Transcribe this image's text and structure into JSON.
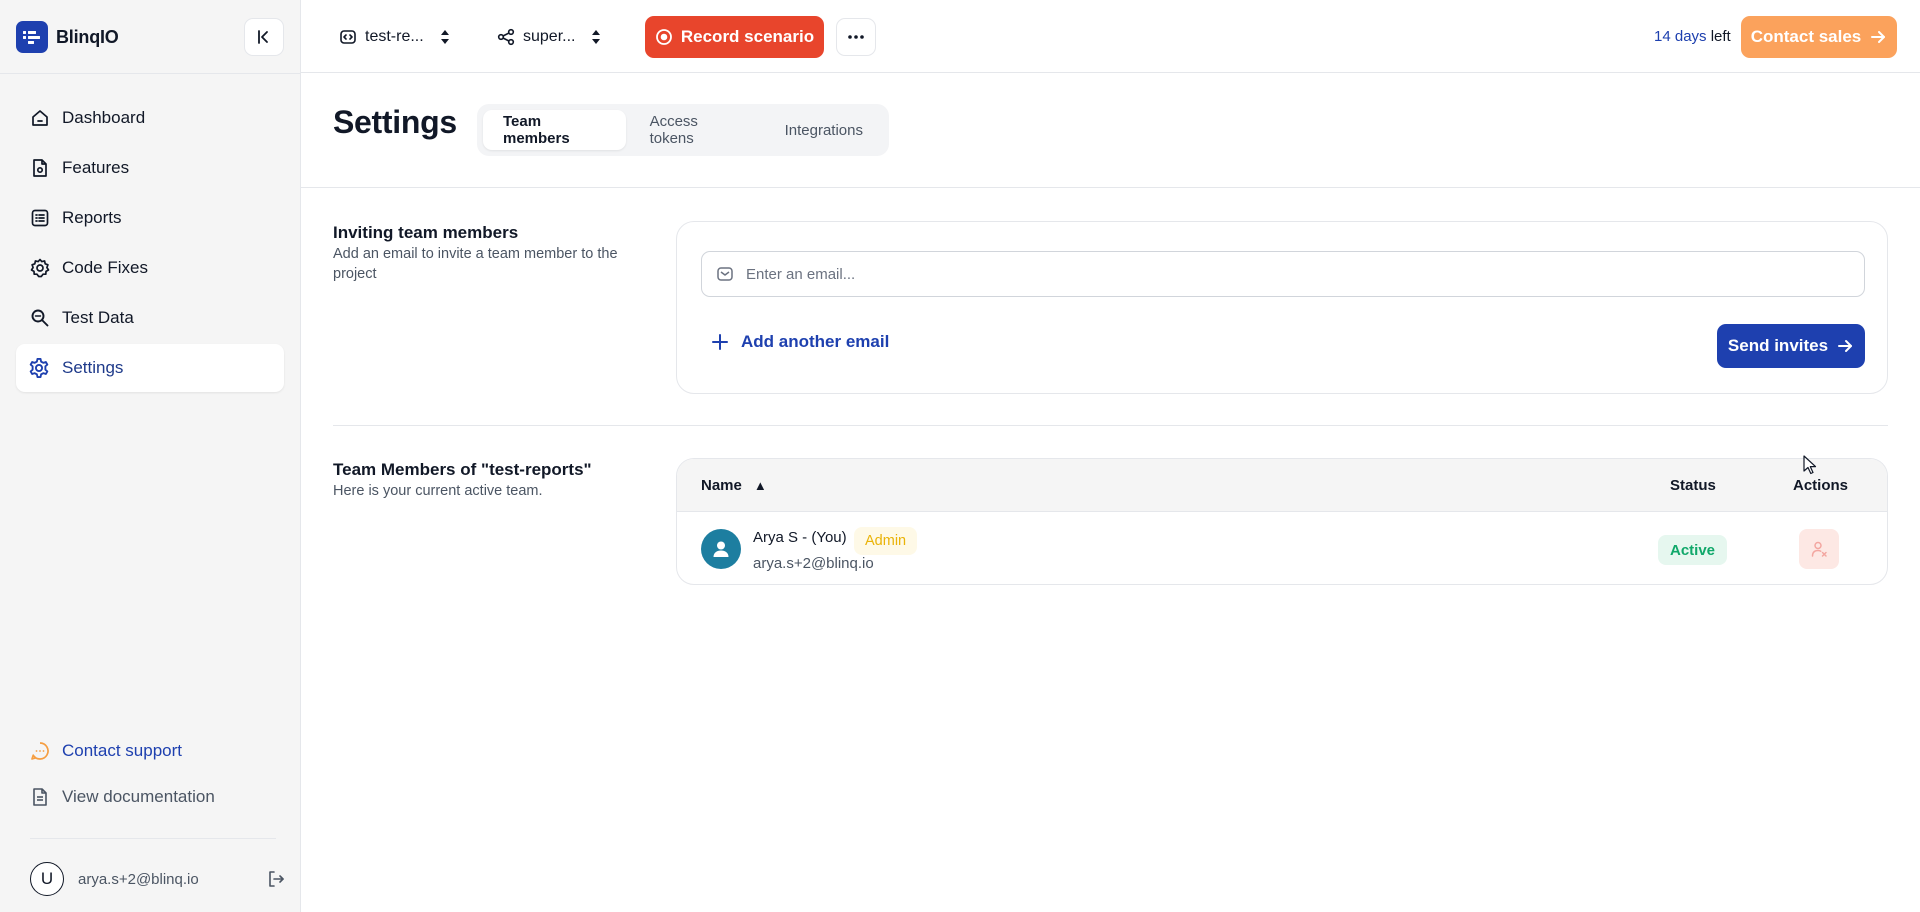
{
  "sidebar": {
    "brand_name": "BlinqIO",
    "nav": [
      {
        "label": "Dashboard",
        "icon": "home-icon"
      },
      {
        "label": "Features",
        "icon": "feature-file-icon"
      },
      {
        "label": "Reports",
        "icon": "list-icon"
      },
      {
        "label": "Code Fixes",
        "icon": "gear-badge-icon"
      },
      {
        "label": "Test Data",
        "icon": "search-data-icon"
      },
      {
        "label": "Settings",
        "icon": "gear-icon",
        "active": true
      }
    ],
    "contact_support": "Contact support",
    "view_documentation": "View documentation",
    "user_initial": "U",
    "user_email": "arya.s+2@blinq.io"
  },
  "topbar": {
    "project_selector": "test-re...",
    "env_selector": "super...",
    "record_label": "Record scenario",
    "trial_days": "14 days",
    "trial_left": "left",
    "contact_sales_label": "Contact sales"
  },
  "page": {
    "title": "Settings",
    "tabs": [
      {
        "label": "Team members",
        "active": true
      },
      {
        "label": "Access tokens",
        "active": false
      },
      {
        "label": "Integrations",
        "active": false
      }
    ]
  },
  "invite": {
    "title": "Inviting team members",
    "description": "Add an email to invite a team member to the project",
    "email_placeholder": "Enter an email...",
    "email_value": "",
    "add_another_label": "Add another email",
    "send_label": "Send invites"
  },
  "members": {
    "title": "Team Members of \"test-reports\"",
    "description": "Here is your current active team.",
    "columns": {
      "name": "Name",
      "sort_indicator": "▲",
      "status": "Status",
      "actions": "Actions"
    },
    "rows": [
      {
        "name": "Arya S - (You)",
        "role": "Admin",
        "email": "arya.s+2@blinq.io",
        "status": "Active"
      }
    ]
  },
  "colors": {
    "accent_blue": "#1e40af",
    "record_red": "#e8452c",
    "contact_orange": "#fba25c",
    "status_green": "#10a86a",
    "admin_yellow": "#eab308"
  }
}
